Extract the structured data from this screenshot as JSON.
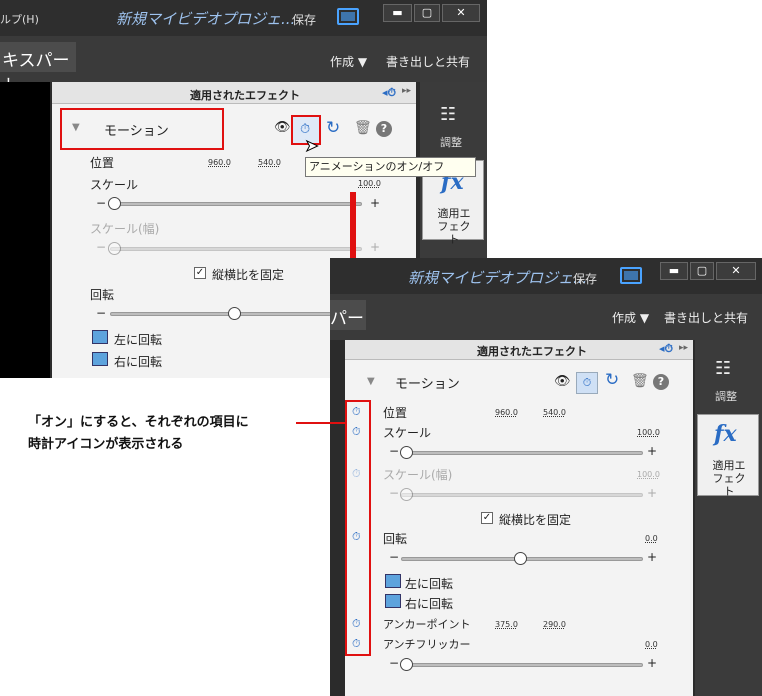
{
  "back": {
    "menu_fragment": "ルプ(H)",
    "title": "新規マイビデオプロジェ...",
    "save": "保存",
    "tab_fragment": "キスパート",
    "create": "作成 ▼",
    "export": "書き出しと共有",
    "panel_title": "適用されたエフェクト",
    "motion": "モーション",
    "position": "位置",
    "pos_x": "960.0",
    "pos_y": "540.0",
    "scale": "スケール",
    "scale_val": "100.0",
    "scale_w": "スケール(幅)",
    "aspect": "縦横比を固定",
    "rotation": "回転",
    "rotate_left": "左に回転",
    "rotate_right": "右に回転",
    "adjust": "調整",
    "applied_fx": "適用エ\nフェクト"
  },
  "tooltip": "アニメーションのオン/オフ",
  "front": {
    "title": "新規マイビデオプロジェ...",
    "save": "保存",
    "tab_fragment": "パー",
    "create": "作成 ▼",
    "export": "書き出しと共有",
    "panel_title": "適用されたエフェクト",
    "motion": "モーション",
    "position": "位置",
    "pos_x": "960.0",
    "pos_y": "540.0",
    "scale": "スケール",
    "scale_val": "100.0",
    "scale_w": "スケール(幅)",
    "scale_w_val": "100.0",
    "aspect": "縦横比を固定",
    "rotation": "回転",
    "rotation_val": "0.0",
    "rotate_left": "左に回転",
    "rotate_right": "右に回転",
    "anchor": "アンカーポイント",
    "anchor_x": "375.0",
    "anchor_y": "290.0",
    "antiflicker": "アンチフリッカー",
    "antiflicker_val": "0.0",
    "adjust": "調整",
    "fx": "fx",
    "applied_fx": "適用エ\nフェクト"
  },
  "callout": {
    "line1": "「オン」にすると、それぞれの項目に",
    "line2": "時計アイコンが表示される"
  },
  "colors": {
    "highlight": "#e01010",
    "accent": "#2a6cc4",
    "title": "#9ec3ef"
  }
}
